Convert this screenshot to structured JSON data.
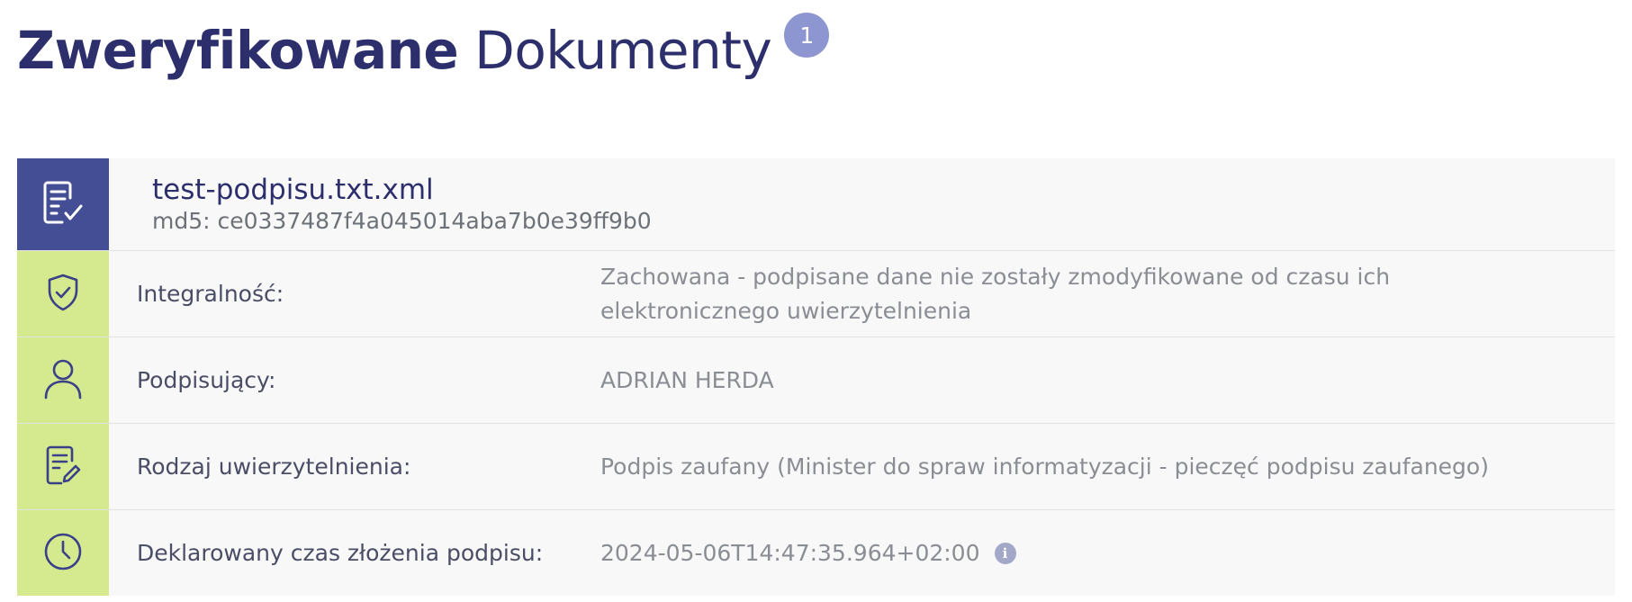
{
  "header": {
    "title_bold": "Zweryfikowane",
    "title_regular": "Dokumenty",
    "count": "1"
  },
  "document": {
    "name": "test-podpisu.txt.xml",
    "hash": "md5: ce0337487f4a045014aba7b0e39ff9b0",
    "icon": "document-check-icon"
  },
  "details": [
    {
      "icon": "shield-check-icon",
      "label": "Integralność:",
      "value_line1": "Zachowana - podpisane dane nie zostały zmodyfikowane od czasu ich",
      "value_line2": "elektronicznego uwierzytelnienia"
    },
    {
      "icon": "user-icon",
      "label": "Podpisujący:",
      "value": "ADRIAN HERDA"
    },
    {
      "icon": "document-edit-icon",
      "label": "Rodzaj uwierzytelnienia:",
      "value": "Podpis zaufany (Minister do spraw informatyzacji - pieczęć podpisu zaufanego)"
    },
    {
      "icon": "clock-icon",
      "label": "Deklarowany czas złożenia podpisu:",
      "value": "2024-05-06T14:47:35.964+02:00",
      "info_icon": "info-icon"
    }
  ],
  "colors": {
    "title": "#2c2f6b",
    "badge": "#8e96d1",
    "doc_icon_bg": "#434e94",
    "detail_icon_bg": "#d5e98e",
    "card_bg": "#f8f8f8"
  }
}
